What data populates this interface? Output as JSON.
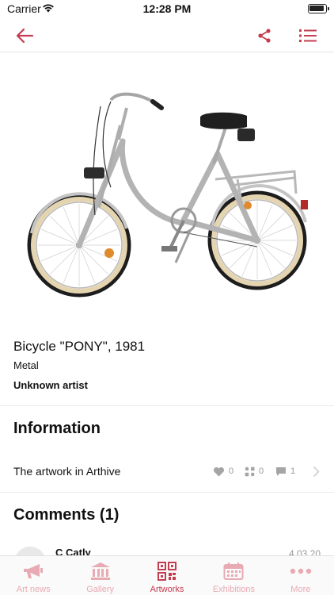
{
  "status": {
    "carrier": "Carrier",
    "time": "12:28 PM"
  },
  "colors": {
    "accent": "#c33d50",
    "accent_light": "#e8aab3",
    "divider": "#ebebeb"
  },
  "nav": {
    "back_icon": "arrow-left-icon",
    "share_icon": "share-icon",
    "menu_icon": "list-icon"
  },
  "artwork": {
    "image_alt": "bicycle photo",
    "title": "Bicycle \"PONY\", 1981",
    "medium": "Metal",
    "artist": "Unknown artist"
  },
  "information": {
    "heading": "Information",
    "label": "The artwork in Arthive",
    "likes": "0",
    "collections": "0",
    "comments": "1"
  },
  "comments": {
    "heading": "Comments (1)",
    "first_author": "C Catly",
    "first_date": "4.03.20"
  },
  "tabs": [
    {
      "label": "Art news",
      "icon": "megaphone-icon",
      "active": false
    },
    {
      "label": "Gallery",
      "icon": "museum-icon",
      "active": false
    },
    {
      "label": "Artworks",
      "icon": "qr-grid-icon",
      "active": true
    },
    {
      "label": "Exhibitions",
      "icon": "calendar-icon",
      "active": false
    },
    {
      "label": "More",
      "icon": "more-dots-icon",
      "active": false
    }
  ]
}
